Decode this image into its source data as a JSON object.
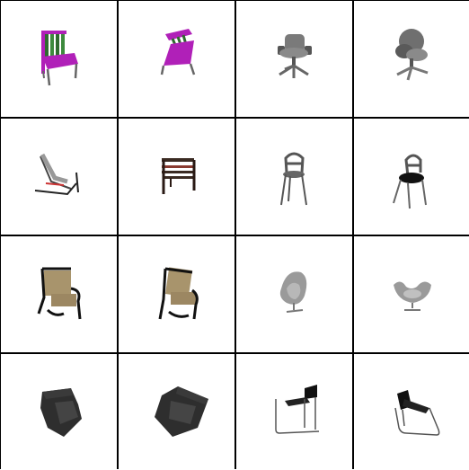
{
  "grid": {
    "rows": 4,
    "columns": 4,
    "background": "#ffffff",
    "border_color": "#000000",
    "thumbnails": [
      {
        "icon": "spindle-back-chair-magenta-green-icon"
      },
      {
        "icon": "spindle-back-chair-magenta-green-tilted-icon"
      },
      {
        "icon": "office-swivel-chair-grey-icon"
      },
      {
        "icon": "office-swivel-chair-grey-rear-icon"
      },
      {
        "icon": "sling-lounge-chair-icon"
      },
      {
        "icon": "slatted-wooden-chair-icon"
      },
      {
        "icon": "bentwood-side-chair-grey-icon"
      },
      {
        "icon": "bentwood-side-chair-black-seat-icon"
      },
      {
        "icon": "woven-armchair-icon"
      },
      {
        "icon": "woven-armchair-rotated-icon"
      },
      {
        "icon": "egg-chair-grey-icon"
      },
      {
        "icon": "egg-chair-grey-front-icon"
      },
      {
        "icon": "cube-armchair-dark-icon"
      },
      {
        "icon": "cube-armchair-dark-rotated-icon"
      },
      {
        "icon": "cantilever-tube-chair-icon"
      },
      {
        "icon": "cantilever-tube-chair-rotated-icon"
      }
    ]
  },
  "colors": {
    "magenta": "#b020b8",
    "green": "#2f6b2f",
    "grey": "#7a7a7a",
    "dark": "#2e2e2e",
    "tan": "#a8946c"
  }
}
